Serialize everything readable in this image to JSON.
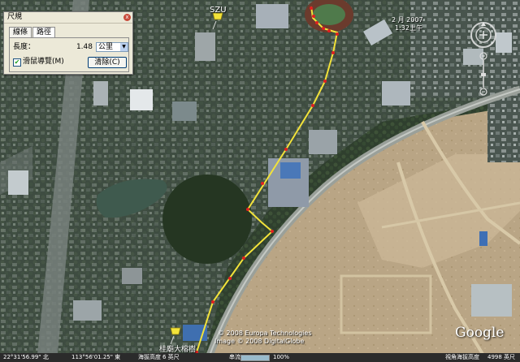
{
  "ruler": {
    "title": "尺規",
    "close": "x",
    "tabs": [
      {
        "label": "線條",
        "active": false
      },
      {
        "label": "路徑",
        "active": true
      }
    ],
    "length_label": "長度：",
    "length_value": "1.48",
    "unit": "公里",
    "mouse_nav_label": "滑鼠導覽(M)",
    "mouse_nav_checked": true,
    "clear_label": "清除(C)"
  },
  "labels": {
    "szu": "SZU",
    "start_place": "桂廟大榕樹",
    "capture_date": "2 月 2007",
    "capture_time": "1:32上午",
    "copyright1": "© 2008 Europa Technologies",
    "copyright2": "Image © 2008 DigitalGlobe"
  },
  "brand": "Google",
  "status": {
    "lat": "22°31'56.99\" 北",
    "lon": "113°56'01.25\" 東",
    "elev_label": "海拔高度",
    "elev": "6 英尺",
    "stream_label": "串流",
    "stream_pct": "100%",
    "eye_label": "視角海拔高度",
    "eye": "4998 英尺"
  }
}
